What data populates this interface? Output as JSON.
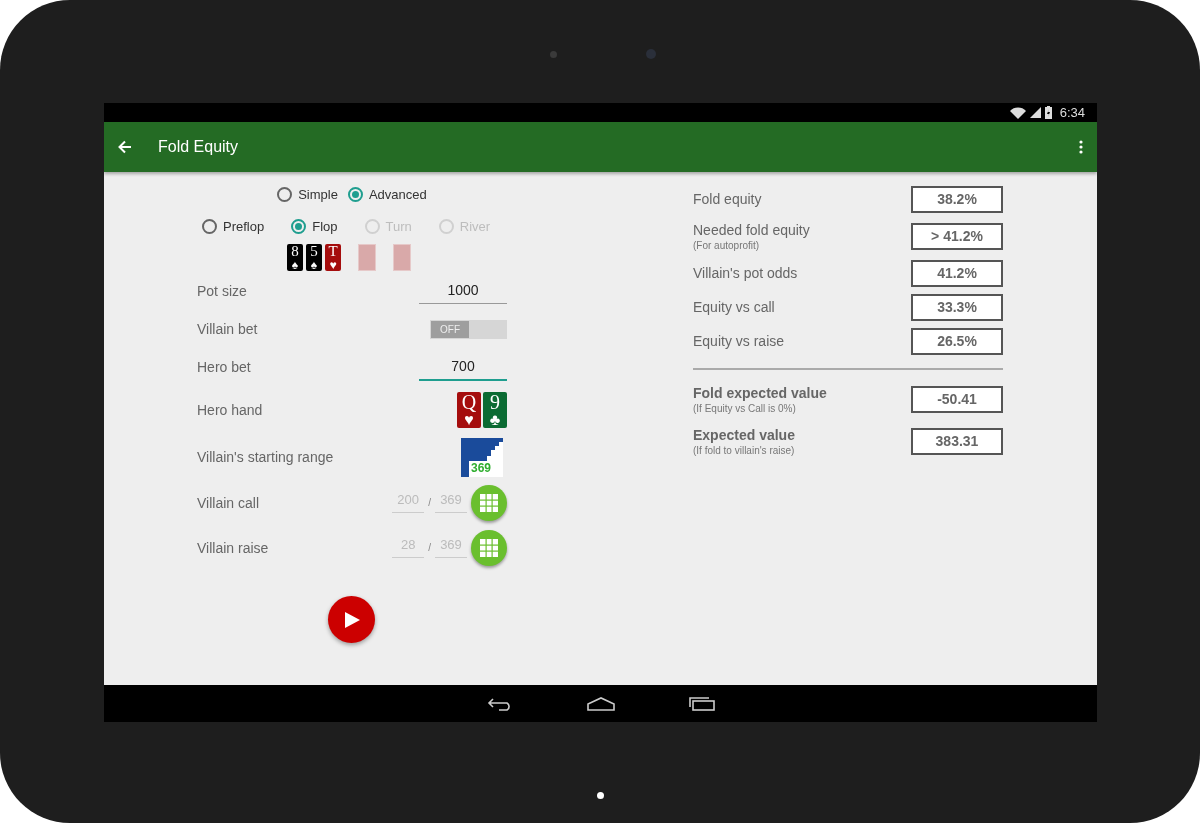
{
  "status_bar": {
    "time": "6:34"
  },
  "app_bar": {
    "title": "Fold Equity"
  },
  "mode": [
    {
      "label": "Simple",
      "selected": false
    },
    {
      "label": "Advanced",
      "selected": true
    }
  ],
  "street": [
    {
      "label": "Preflop",
      "selected": false,
      "disabled": false
    },
    {
      "label": "Flop",
      "selected": true,
      "disabled": false
    },
    {
      "label": "Turn",
      "selected": false,
      "disabled": true
    },
    {
      "label": "River",
      "selected": false,
      "disabled": true
    }
  ],
  "board": [
    {
      "kind": "card",
      "rank": "8",
      "suit": "♠",
      "color": "#000000"
    },
    {
      "kind": "card",
      "rank": "5",
      "suit": "♠",
      "color": "#000000"
    },
    {
      "kind": "card",
      "rank": "T",
      "suit": "♥",
      "color": "#a50d0d"
    },
    {
      "kind": "slot"
    },
    {
      "kind": "slot"
    }
  ],
  "form": [
    {
      "kind": "field",
      "label": "Pot size",
      "value": "1000",
      "focused": false
    },
    {
      "kind": "toggle",
      "label": "Villain bet",
      "on": false,
      "state_text": "OFF"
    },
    {
      "kind": "field",
      "label": "Hero bet",
      "value": "700",
      "focused": true
    },
    {
      "kind": "hand",
      "label": "Hero hand",
      "cards": [
        {
          "rank": "Q",
          "suit": "♥",
          "color": "#a50d0d"
        },
        {
          "rank": "9",
          "suit": "♣",
          "color": "#0b6b33"
        }
      ]
    },
    {
      "kind": "range",
      "label": "Villain's starting range",
      "count": "369"
    },
    {
      "kind": "combos",
      "label": "Villain call",
      "value": "200",
      "separator": "/",
      "total": "369"
    },
    {
      "kind": "combos",
      "label": "Villain raise",
      "value": "28",
      "separator": "/",
      "total": "369"
    }
  ],
  "results": [
    {
      "label": "Fold equity",
      "value": "38.2%",
      "bold": false
    },
    {
      "label": "Needed fold equity",
      "note": "(For autoprofit)",
      "value": "> 41.2%",
      "bold": false
    },
    {
      "label": "Villain's pot odds",
      "value": "41.2%",
      "bold": false
    },
    {
      "label": "Equity vs call",
      "value": "33.3%",
      "bold": false
    },
    {
      "label": "Equity vs raise",
      "value": "26.5%",
      "bold": false
    }
  ],
  "expected": [
    {
      "label": "Fold expected value",
      "note": "(If Equity vs Call is 0%)",
      "value": "-50.41",
      "bold": true
    },
    {
      "label": "Expected value",
      "note": "(If fold to villain's raise)",
      "value": "383.31",
      "bold": true
    }
  ]
}
